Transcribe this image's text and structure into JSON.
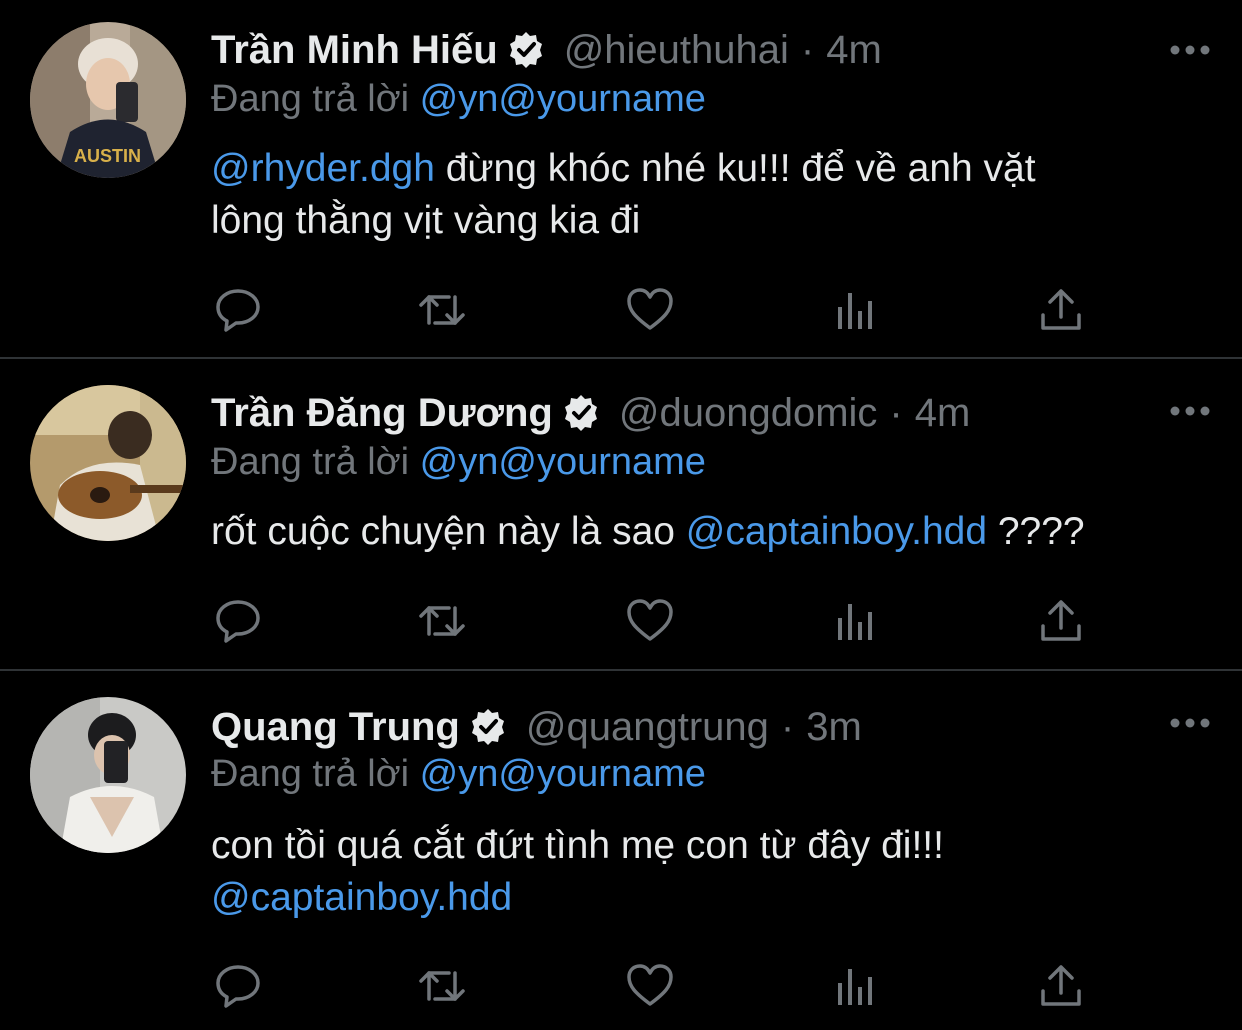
{
  "tweets": [
    {
      "display_name": "Trần Minh Hiếu",
      "handle": "@hieuthuhai",
      "separator": "·",
      "time": "4m",
      "reply_prefix": "Đang trả lời",
      "reply_to": "@yn@yourname",
      "body_line1_mention": "@rhyder.dgh",
      "body_line1_text": " đừng khóc nhé ku!!! để về anh vặt",
      "body_line2_text": "lông thằng vịt vàng kia đi",
      "avatar_icon": "avatar-photo-icon"
    },
    {
      "display_name": "Trần Đăng Dương",
      "handle": "@duongdomic",
      "separator": "·",
      "time": "4m",
      "reply_prefix": "Đang trả lời",
      "reply_to": "@yn@yourname",
      "body_line1_text": "rốt cuộc chuyện này là sao ",
      "body_line1_mention": "@captainboy.hdd",
      "body_line1_suffix": " ????",
      "avatar_icon": "avatar-photo-icon"
    },
    {
      "display_name": "Quang Trung",
      "handle": "@quangtrung",
      "separator": "·",
      "time": "3m",
      "reply_prefix": "Đang trả lời",
      "reply_to": "@yn@yourname",
      "body_line1_text": "con tồi quá cắt đứt tình mẹ con từ đây đi!!!",
      "body_line2_mention": "@captainboy.hdd",
      "avatar_icon": "avatar-photo-icon"
    }
  ],
  "icons": {
    "verified": "verified-badge-icon",
    "more": "more-options-icon",
    "reply": "reply-icon",
    "retweet": "retweet-icon",
    "like": "heart-icon",
    "analytics": "analytics-icon",
    "share": "share-icon"
  },
  "colors": {
    "background": "#000000",
    "text": "#e7e9ea",
    "muted": "#71767b",
    "link": "#4a99e9",
    "divider": "#2f3336"
  }
}
